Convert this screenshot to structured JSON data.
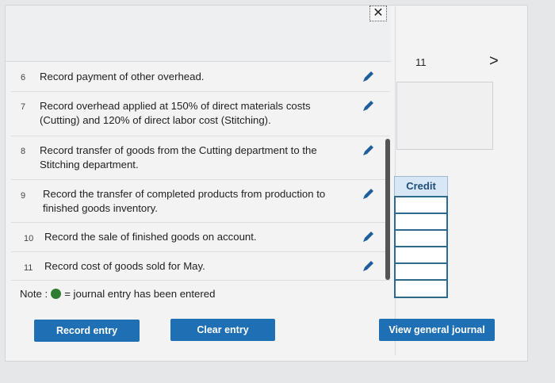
{
  "header": {
    "close_label": "✕"
  },
  "entries": [
    {
      "num": "6",
      "text": "Record payment of other overhead."
    },
    {
      "num": "7",
      "text": "Record overhead applied at 150% of direct materials costs (Cutting) and 120% of direct labor cost (Stitching)."
    },
    {
      "num": "8",
      "text": "Record transfer of goods from the Cutting department to the Stitching department."
    },
    {
      "num": "9",
      "text": "Record the transfer of completed products from production to finished goods inventory."
    },
    {
      "num": "10",
      "text": "Record the sale of finished goods on account."
    },
    {
      "num": "11",
      "text": "Record cost of goods sold for May."
    }
  ],
  "note": {
    "prefix": "Note :",
    "suffix": "= journal entry has been entered"
  },
  "right": {
    "page": "11",
    "next": ">",
    "credit_header": "Credit"
  },
  "buttons": {
    "record": "Record entry",
    "clear": "Clear entry",
    "view": "View general journal"
  },
  "colors": {
    "button": "#1f6fb5",
    "dot": "#2f7d32"
  }
}
